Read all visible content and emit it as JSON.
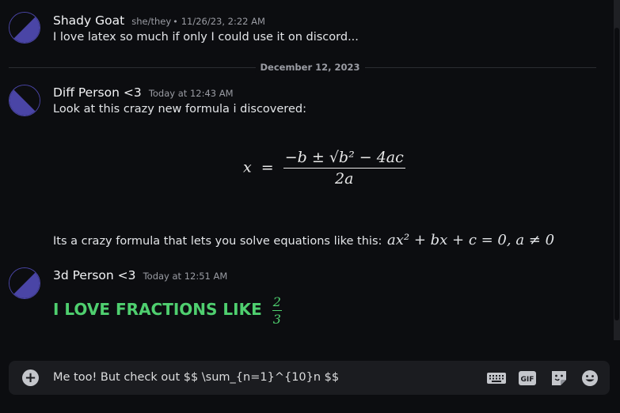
{
  "messages": [
    {
      "author": "Shady Goat",
      "pronouns": "she/they",
      "timestamp": "11/26/23, 2:22 AM",
      "text": "I love latex so much if only I could use it on discord..."
    },
    {
      "author": "Diff Person <3",
      "timestamp": "Today at 12:43 AM",
      "text": "Look at this crazy new formula i discovered:",
      "formula": {
        "lhs": "x",
        "numerator": "−b ± √b² − 4ac",
        "denominator": "2a"
      },
      "followup": "Its a crazy formula that lets you solve equations like this:",
      "followup_math": "ax² + bx + c = 0, a ≠ 0"
    },
    {
      "author": "3d Person <3",
      "timestamp": "Today at 12:51 AM",
      "text": "I LOVE FRACTIONS LIKE",
      "fraction": {
        "numerator": "2",
        "denominator": "3"
      }
    }
  ],
  "divider": {
    "label": "December 12, 2023"
  },
  "composer": {
    "value": "Me too! But check out $$ \\sum_{n=1}^{10}n $$",
    "icons": [
      "plus-icon",
      "keyboard-icon",
      "gif-icon",
      "sticker-icon",
      "emoji-icon"
    ]
  },
  "colors": {
    "accent_green": "#4fcf6f",
    "avatar": "#4a45a6",
    "background": "#0c0d10"
  }
}
